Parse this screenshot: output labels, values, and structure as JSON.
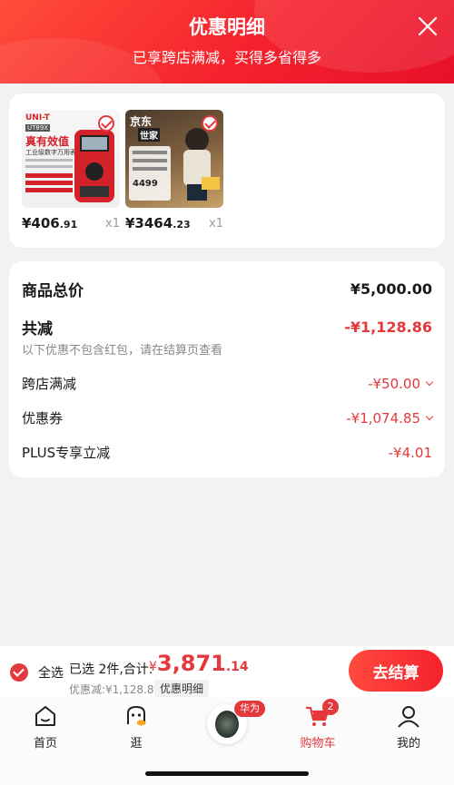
{
  "header": {
    "title": "优惠明细",
    "subtitle": "已享跨店满减，买得多省得多"
  },
  "products": [
    {
      "image_brand": "UNI-T",
      "image_model": "UT89X",
      "image_headline": "真有效值",
      "image_caption": "工业级数字万用表",
      "price_int": "¥406",
      "price_dec": ".91",
      "qty": "x1"
    },
    {
      "image_brand": "京东",
      "image_brand2": "世家",
      "image_price": "4499",
      "price_int": "¥3464",
      "price_dec": ".23",
      "qty": "x1"
    }
  ],
  "summary": {
    "total_label": "商品总价",
    "total_value": "¥5,000.00",
    "reduce_label": "共减",
    "reduce_value": "-¥1,128.86",
    "reduce_note": "以下优惠不包含红包，请在结算页查看",
    "items": [
      {
        "label": "跨店满减",
        "value": "-¥50.00",
        "expandable": true
      },
      {
        "label": "优惠券",
        "value": "-¥1,074.85",
        "expandable": true
      },
      {
        "label": "PLUS专享立减",
        "value": "-¥4.01",
        "expandable": false
      }
    ]
  },
  "checkout": {
    "select_all": "全选",
    "selected_text": "已选 2件,合计:",
    "currency": "¥",
    "total_int": "3,871",
    "total_dec": ".14",
    "discount_text": "优惠减:¥1,128.86",
    "detail_button": "优惠明细",
    "checkout_button": "去结算"
  },
  "tabbar": {
    "items": [
      {
        "label": "首页",
        "icon": "home-icon"
      },
      {
        "label": "逛",
        "icon": "stroll-icon"
      },
      {
        "label": "华为",
        "icon": "watch-icon"
      },
      {
        "label": "购物车",
        "icon": "cart-icon",
        "badge": "2",
        "active": true
      },
      {
        "label": "我的",
        "icon": "profile-icon"
      }
    ]
  },
  "colors": {
    "accent": "#e4393c",
    "header_gradient_start": "#ff4d3a",
    "header_gradient_end": "#e8102a"
  }
}
